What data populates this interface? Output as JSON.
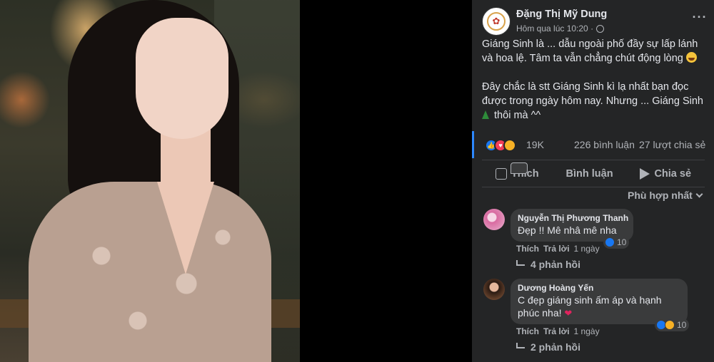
{
  "post": {
    "author": "Đặng Thị Mỹ Dung",
    "time": "Hôm qua lúc 10:20 ·",
    "caption_p1": "Giáng Sinh là ... dẫu ngoài phố đầy sự lấp lánh và hoa lệ. Tâm ta vẫn chẳng chút động lòng",
    "caption_p2a": "Đây chắc là stt Giáng Sinh kì lạ nhất bạn đọc được trong ngày hôm nay. Nhưng ... Giáng Sinh",
    "caption_p2b": "thôi mà ^^"
  },
  "stats": {
    "reactions": "19K",
    "comments": "226 bình luận",
    "shares": "27 lượt chia sẻ"
  },
  "actions": {
    "like": "Thích",
    "comment": "Bình luận",
    "share": "Chia sẻ"
  },
  "sort_label": "Phù hợp nhất",
  "comments": [
    {
      "name": "Nguyễn Thị Phương Thanh",
      "text": "Đẹp !! Mê nhâ mê nha",
      "like": "Thích",
      "reply": "Trả lời",
      "time": "1 ngày",
      "reactions": "10",
      "replies": "4 phản hồi"
    },
    {
      "name": "Dương Hoàng Yến",
      "text": "C đẹp giáng sinh ấm áp và hạnh phúc nha!",
      "like": "Thích",
      "reply": "Trả lời",
      "time": "1 ngày",
      "reactions": "10",
      "replies": "2 phản hồi"
    }
  ],
  "icons": {
    "more": "more-options-icon",
    "privacy": "globe-icon",
    "like": "thumbs-up-icon",
    "comment": "comment-bubble-icon",
    "share": "share-arrow-icon"
  },
  "colors": {
    "panel_bg": "#242526",
    "bubble_bg": "#3a3b3c",
    "like_blue": "#1877f2",
    "love_red": "#f33e58",
    "haha_yellow": "#f7b125",
    "selection": "#2d88ff"
  }
}
